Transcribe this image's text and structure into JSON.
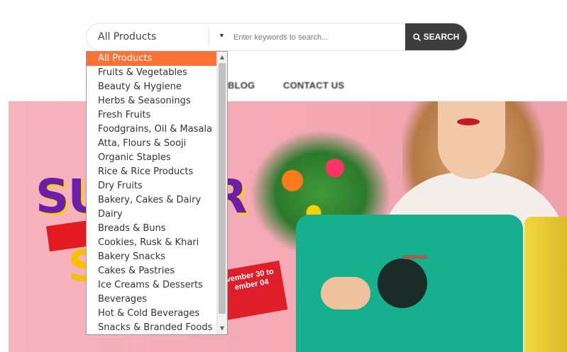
{
  "search": {
    "category_selected": "All Products",
    "arrow_glyph": "▼",
    "placeholder": "Enter keywords to search...",
    "button_label": "SEARCH",
    "button_icon": "search-icon"
  },
  "nav": {
    "items": [
      "BLOG",
      "CONTACT US"
    ]
  },
  "banner": {
    "promo_title_start": "SU",
    "promo_title_end": "R",
    "promo_sub": "S",
    "date_text": "vember 30 to ember 04"
  },
  "dropdown": {
    "options": [
      "All Products",
      "Fruits & Vegetables",
      "Beauty & Hygiene",
      "Herbs & Seasonings",
      "Fresh Fruits",
      "Foodgrains, Oil & Masala",
      "Atta, Flours & Sooji",
      "Organic Staples",
      "Rice & Rice Products",
      "Dry Fruits",
      "Bakery, Cakes & Dairy",
      "Dairy",
      "Breads & Buns",
      "Cookies, Rusk & Khari",
      "Bakery Snacks",
      "Cakes & Pastries",
      "Ice Creams & Desserts",
      "Beverages",
      "Hot & Cold Beverages",
      "Snacks & Branded Foods"
    ],
    "selected_index": 0
  },
  "colors": {
    "accent": "#ff7133",
    "button_bg": "#3d3d3d",
    "banner_bg": "#f4a9b5"
  }
}
